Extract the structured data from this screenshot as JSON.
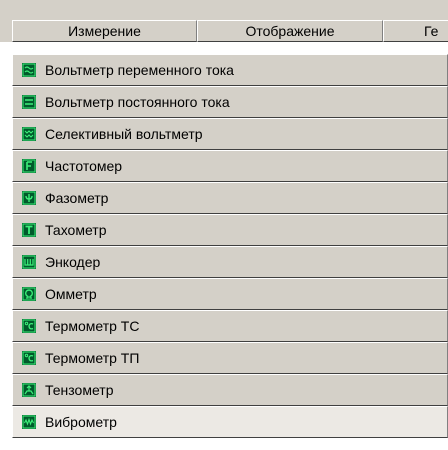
{
  "tabs": [
    {
      "label": "Измерение"
    },
    {
      "label": "Отображение"
    },
    {
      "label": "Ге"
    }
  ],
  "instruments": [
    {
      "label": "Вольтметр переменного тока",
      "icon": "ac-voltmeter-icon"
    },
    {
      "label": "Вольтметр постоянного тока",
      "icon": "dc-voltmeter-icon"
    },
    {
      "label": "Селективный вольтметр",
      "icon": "selective-voltmeter-icon"
    },
    {
      "label": "Частотомер",
      "icon": "frequency-meter-icon"
    },
    {
      "label": "Фазометр",
      "icon": "phase-meter-icon"
    },
    {
      "label": "Тахометр",
      "icon": "tachometer-icon"
    },
    {
      "label": "Энкодер",
      "icon": "encoder-icon"
    },
    {
      "label": "Омметр",
      "icon": "ohmmeter-icon"
    },
    {
      "label": "Термометр ТС",
      "icon": "thermometer-ts-icon"
    },
    {
      "label": "Термометр ТП",
      "icon": "thermometer-tp-icon"
    },
    {
      "label": "Тензометр",
      "icon": "strain-gauge-icon"
    },
    {
      "label": "Виброметр",
      "icon": "vibrometer-icon"
    }
  ],
  "colors": {
    "icon_bg": "#005a2b",
    "icon_fg": "#3cf07a",
    "panel": "#d4d0c8"
  }
}
